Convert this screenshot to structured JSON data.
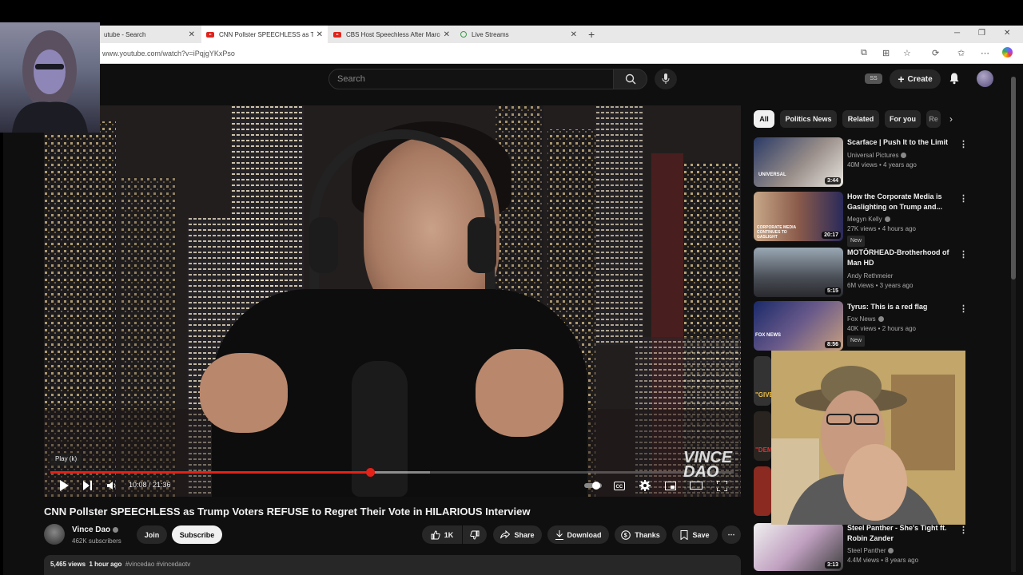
{
  "browser": {
    "tabs": [
      {
        "label": "utube - Search",
        "active": false,
        "favicon": "youtube-icon"
      },
      {
        "label": "CNN Pollster SPEECHLESS as Tru",
        "active": true,
        "favicon": "youtube-icon"
      },
      {
        "label": "CBS Host Speechless After Marco",
        "active": false,
        "favicon": "youtube-icon"
      },
      {
        "label": "Live Streams",
        "active": false,
        "favicon": "rumble-icon"
      }
    ],
    "url": "www.youtube.com/watch?v=iPqjgYKxPso"
  },
  "header": {
    "search_placeholder": "Search",
    "profile_badge": "SS",
    "create_label": "Create"
  },
  "player": {
    "tooltip": "Play (k)",
    "current_time": "10:08",
    "duration": "21:36",
    "time_display": "10:08 / 21:36",
    "progress_fraction": 0.468,
    "buffer_fraction": 0.555,
    "watermark": "VINCE DAO"
  },
  "video": {
    "title": "CNN Pollster SPEECHLESS as Trump Voters REFUSE to Regret Their Vote in HILARIOUS Interview",
    "channel_name": "Vince Dao",
    "subscribers": "462K subscribers",
    "join_label": "Join",
    "subscribe_label": "Subscribe",
    "likes": "1K",
    "share_label": "Share",
    "download_label": "Download",
    "thanks_label": "Thanks",
    "save_label": "Save",
    "views": "5,465 views",
    "posted": "1 hour ago",
    "tags": "#vincedao #vincedaotv"
  },
  "chips": [
    "All",
    "Politics News",
    "Related",
    "For you",
    "Re"
  ],
  "recommendations": [
    {
      "title": "Scarface | Push It to the Limit",
      "channel": "Universal Pictures",
      "meta": "40M views • 4 years ago",
      "duration": "3:44",
      "new": false
    },
    {
      "title": "How the Corporate Media is Gaslighting on Trump and...",
      "channel": "Megyn Kelly",
      "meta": "27K views • 4 hours ago",
      "duration": "20:17",
      "new": true
    },
    {
      "title": "MOTÖRHEAD-Brotherhood of Man HD",
      "channel": "Andy Rethmeier",
      "meta": "6M views • 3 years ago",
      "duration": "5:15",
      "new": false
    },
    {
      "title": "Tyrus: This is a red flag",
      "channel": "Fox News",
      "meta": "40K views • 2 hours ago",
      "duration": "8:56",
      "new": true
    },
    {
      "title": "Steel Panther - She's Tight ft. Robin Zander",
      "channel": "Steel Panther",
      "meta": "4.4M views • 8 years ago",
      "duration": "3:13",
      "new": false
    }
  ],
  "thumb_texts": {
    "universal": "UNIVERSAL",
    "corporate": "CORPORATE MEDIA CONTINUES TO GASLIGHT",
    "fox": "FOX NEWS",
    "give": "\"GIVE",
    "dem": "\"DEM"
  },
  "new_badge": "New",
  "colors": {
    "accent_red": "#e62117",
    "page_bg": "#0f0f0f",
    "chip_bg": "#272727"
  }
}
